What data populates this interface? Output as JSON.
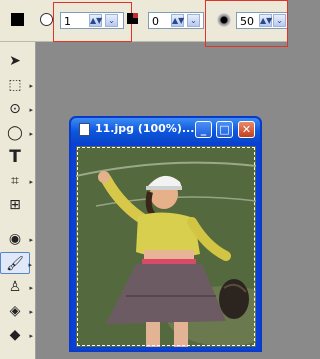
{
  "options": {
    "stroke_width": "1",
    "blend_value": "0",
    "size": "50"
  },
  "document": {
    "title": "11.jpg (100%)..."
  },
  "icons": {
    "tools": [
      "move-arrow",
      "marquee",
      "lasso",
      "shape",
      "text",
      "crop",
      "frame",
      "eye",
      "brush",
      "stamp",
      "eraser",
      "bucket"
    ]
  },
  "colors": {
    "highlight": "#e0332a",
    "title_bar": "#0d56e0"
  }
}
